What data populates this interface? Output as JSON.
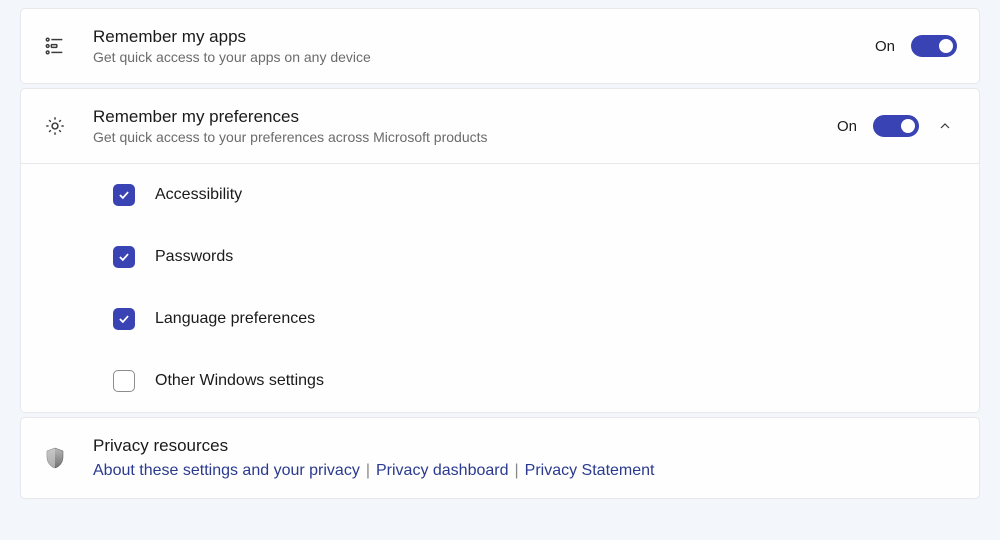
{
  "apps": {
    "title": "Remember my apps",
    "desc": "Get quick access to your apps on any device",
    "status": "On"
  },
  "prefs": {
    "title": "Remember my preferences",
    "desc": "Get quick access to your preferences across Microsoft products",
    "status": "On",
    "items": [
      {
        "label": "Accessibility",
        "checked": true
      },
      {
        "label": "Passwords",
        "checked": true
      },
      {
        "label": "Language preferences",
        "checked": true
      },
      {
        "label": "Other Windows settings",
        "checked": false
      }
    ]
  },
  "privacy": {
    "title": "Privacy resources",
    "links": [
      "About these settings and your privacy",
      "Privacy dashboard",
      "Privacy Statement"
    ]
  }
}
